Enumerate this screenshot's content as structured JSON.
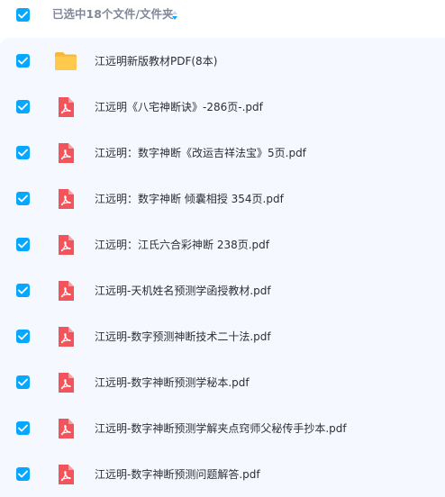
{
  "header": {
    "select_all_checked": true,
    "selection_text": "已选中18个文件/文件夹"
  },
  "colors": {
    "checkbox": "#06a7ff",
    "list_background": "#f5f9ff",
    "header_text": "#818999",
    "pdf_icon": "#f2545b",
    "folder_icon": "#ffc94d"
  },
  "files": [
    {
      "name": "江远明新版教材PDF(8本)",
      "type": "folder",
      "icon": "folder-icon",
      "checked": true
    },
    {
      "name": "江远明《八宅神断诀》-286页-.pdf",
      "type": "pdf",
      "icon": "pdf-icon",
      "checked": true
    },
    {
      "name": "江远明：数字神断《改运吉祥法宝》5页.pdf",
      "type": "pdf",
      "icon": "pdf-icon",
      "checked": true
    },
    {
      "name": "江远明：数字神断 倾囊相授 354页.pdf",
      "type": "pdf",
      "icon": "pdf-icon",
      "checked": true
    },
    {
      "name": "江远明：江氏六合彩神断 238页.pdf",
      "type": "pdf",
      "icon": "pdf-icon",
      "checked": true
    },
    {
      "name": "江远明-天机姓名预测学函授教材.pdf",
      "type": "pdf",
      "icon": "pdf-icon",
      "checked": true
    },
    {
      "name": "江远明-数字预测神断技术二十法.pdf",
      "type": "pdf",
      "icon": "pdf-icon",
      "checked": true
    },
    {
      "name": "江远明-数字神断预测学秘本.pdf",
      "type": "pdf",
      "icon": "pdf-icon",
      "checked": true
    },
    {
      "name": "江远明-数字神断预测学解夹点窍师父秘传手抄本.pdf",
      "type": "pdf",
      "icon": "pdf-icon",
      "checked": true
    },
    {
      "name": "江远明-数字神断预测问题解答.pdf",
      "type": "pdf",
      "icon": "pdf-icon",
      "checked": true
    }
  ]
}
